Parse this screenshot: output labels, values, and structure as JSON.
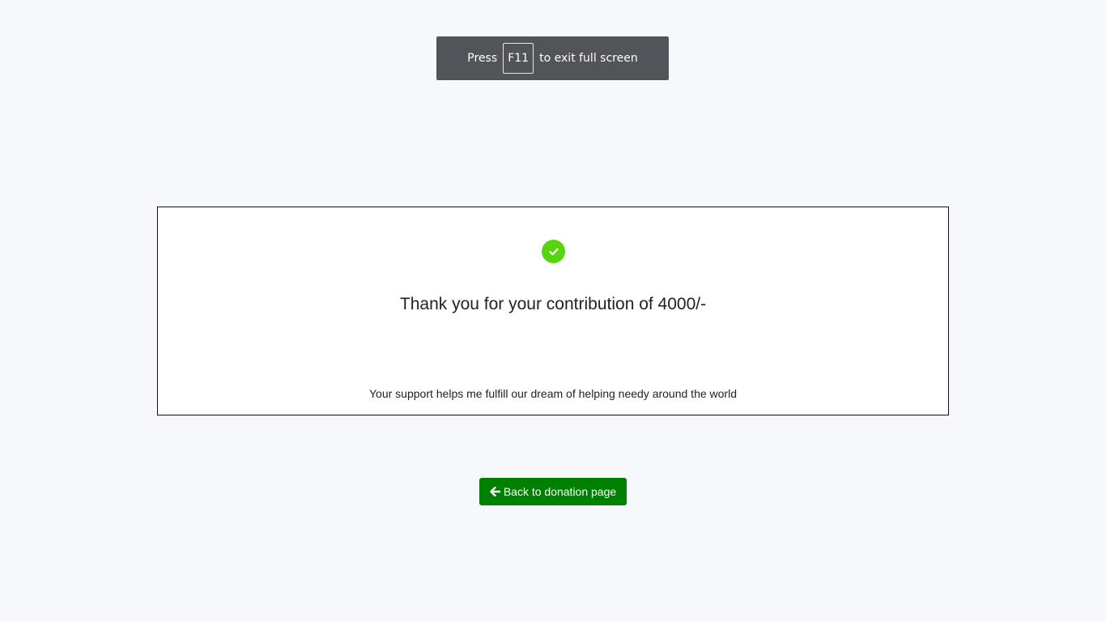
{
  "fullscreen_notice": {
    "prefix": "Press",
    "key": "F11",
    "suffix": "to exit full screen"
  },
  "confirmation": {
    "icon": "check-circle-icon",
    "title": "Thank you for your contribution of 4000/-",
    "message": "Your support helps me fulfill our dream of helping needy around the world"
  },
  "back_button": {
    "icon": "arrow-left-icon",
    "label": "Back to donation page"
  },
  "colors": {
    "background": "#f7f8fc",
    "success": "#57d40d",
    "button": "#008000",
    "notice_bg": "#535459"
  }
}
